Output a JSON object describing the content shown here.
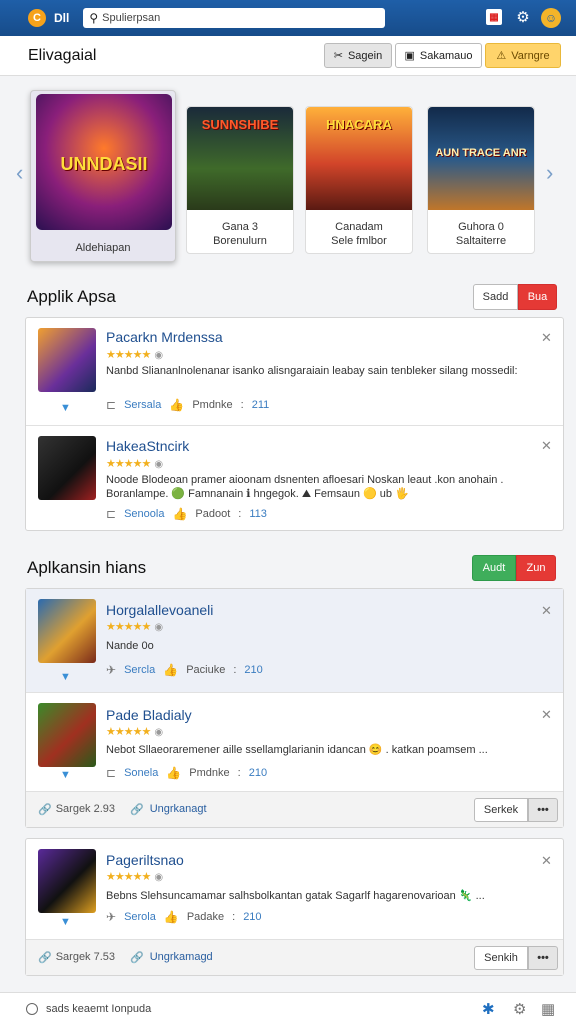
{
  "topbar": {
    "logo_letter": "C",
    "app_label": "Dll",
    "search_value": "Spulierpsan"
  },
  "header": {
    "title": "Elivagaial",
    "buttons": [
      {
        "label": "Sagein",
        "icon": "tools-icon"
      },
      {
        "label": "Sakamauo",
        "icon": "window-icon"
      },
      {
        "label": "Varngre",
        "icon": "warning-icon"
      }
    ]
  },
  "carousel": {
    "featured": {
      "art_text": "UNNDASII",
      "caption": "Aldehiapan"
    },
    "cards": [
      {
        "art_text": "SUNNSHIBE",
        "line1": "Gana 3",
        "line2": "Borenulurn"
      },
      {
        "art_text": "HNACARA",
        "line1": "Canadam",
        "line2": "Sele fmlbor"
      },
      {
        "art_text": "AUN TRACE ANR",
        "line1": "Guhora 0",
        "line2": "Saltaiterre"
      }
    ]
  },
  "section1": {
    "title": "Applik Apsa",
    "seg_a": "Sadd",
    "seg_b": "Bua",
    "items": [
      {
        "name": "Pacarkn Mrdenssa",
        "rating_stars": "★★★★★",
        "desc": "Nanbd Sliananlnolenanar isanko alisngaraiain leabay sain tenbleker silang mossedil:",
        "meta_a": "Sersala",
        "meta_b": "Pmdnke",
        "meta_count": "211"
      },
      {
        "name": "HakeaStncirk",
        "rating_stars": "★★★★★",
        "desc": "Noode Blodeoan pramer aioonam dsnenten afloesari Noskan leaut .kon anohain . Boranlampe. 🟢 Famnanain ℹ hngegok. ⛰ Femsaun 🟡 ub 🖐",
        "meta_a": "Senoola",
        "meta_b": "Padoot",
        "meta_count": "113"
      }
    ]
  },
  "section2": {
    "title": "Aplkansin hians",
    "seg_a": "Audt",
    "seg_b": "Zun",
    "items": [
      {
        "name": "Horgalallevoaneli",
        "rating_stars": "★★★★★",
        "desc": "Nande 0o",
        "meta_a": "Sercla",
        "meta_b": "Paciuke",
        "meta_count": "210"
      },
      {
        "name": "Pade Bladialy",
        "rating_stars": "★★★★★",
        "desc": "Nebot Sllaeoraremener aille ssellamglarianin idancan 😊 . katkan poamsem ...",
        "meta_a": "Sonela",
        "meta_b": "Pmdnke",
        "meta_count": "210"
      }
    ],
    "footer": {
      "size": "Sargek 2.93",
      "upgrade": "Ungrkanagt",
      "button": "Serkek",
      "more": "•••"
    }
  },
  "section3": {
    "items": [
      {
        "name": "Pageriltsnao",
        "rating_stars": "★★★★★",
        "desc": "Bebns Slehsuncamamar salhsbolkantan gatak Sagarlf hagarenovarioan 🦎 ...",
        "meta_a": "Serola",
        "meta_b": "Padake",
        "meta_count": "210"
      }
    ],
    "footer": {
      "size": "Sargek 7.53",
      "upgrade": "Ungrkamagd",
      "button": "Senkih",
      "more": "•••"
    }
  },
  "statusbar": {
    "text": "sads keaemt Ionpuda"
  },
  "colors": {
    "topbar": "#1f5fa8",
    "accent_red": "#e53935",
    "accent_green": "#3fae5b",
    "accent_yellow": "#ffd46b",
    "star": "#f2b01e"
  }
}
